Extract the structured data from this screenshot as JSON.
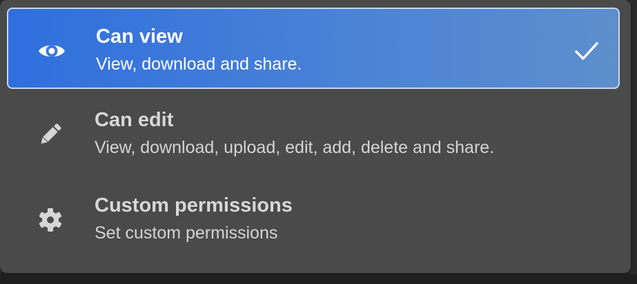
{
  "menu": {
    "items": [
      {
        "title": "Can view",
        "description": "View, download and share.",
        "icon": "eye-icon",
        "selected": true
      },
      {
        "title": "Can edit",
        "description": "View, download, upload, edit, add, delete and share.",
        "icon": "pencil-icon",
        "selected": false
      },
      {
        "title": "Custom permissions",
        "description": "Set custom permissions",
        "icon": "gear-icon",
        "selected": false
      }
    ],
    "colors": {
      "background": "#4a4a4a",
      "selected_background": "#3b78dc",
      "selected_border": "#c6d8f5",
      "text": "#ffffff",
      "muted_text": "#d4d4d4"
    },
    "check_icon": "checkmark-icon"
  }
}
